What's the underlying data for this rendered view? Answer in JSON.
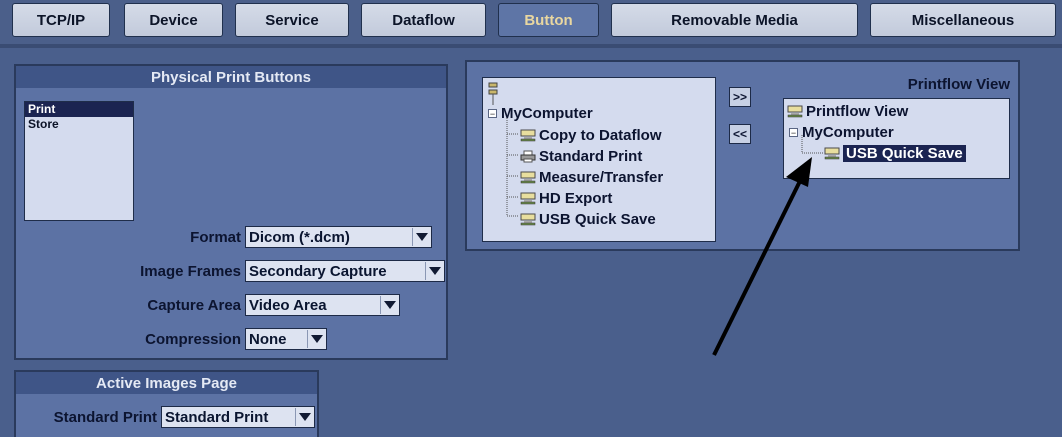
{
  "tabs": [
    {
      "label": "TCP/IP"
    },
    {
      "label": "Device"
    },
    {
      "label": "Service"
    },
    {
      "label": "Dataflow"
    },
    {
      "label": "Button"
    },
    {
      "label": "Removable Media"
    },
    {
      "label": "Miscellaneous"
    }
  ],
  "active_tab": "Button",
  "physical_print": {
    "title": "Physical Print Buttons",
    "items": [
      "Print",
      "Store"
    ],
    "selected": "Print",
    "fields": [
      {
        "label": "Format",
        "value": "Dicom (*.dcm)"
      },
      {
        "label": "Image Frames",
        "value": "Secondary Capture"
      },
      {
        "label": "Capture Area",
        "value": "Video Area"
      },
      {
        "label": "Compression",
        "value": "None"
      }
    ]
  },
  "active_images": {
    "title": "Active Images Page",
    "label": "Standard Print",
    "value": "Standard Print"
  },
  "available_tree": {
    "root": "MyComputer",
    "children": [
      "Copy to Dataflow",
      "Standard Print",
      "Measure/Transfer",
      "HD Export",
      "USB Quick Save"
    ]
  },
  "buttons": {
    "add": ">>",
    "remove": "<<"
  },
  "printflow": {
    "title": "Printflow View",
    "root": "Printflow View",
    "computer": "MyComputer",
    "child": "USB Quick Save"
  },
  "colors": {
    "selection": "#1b2451",
    "panel": "#5c72a4",
    "background": "#4a5f8c"
  }
}
